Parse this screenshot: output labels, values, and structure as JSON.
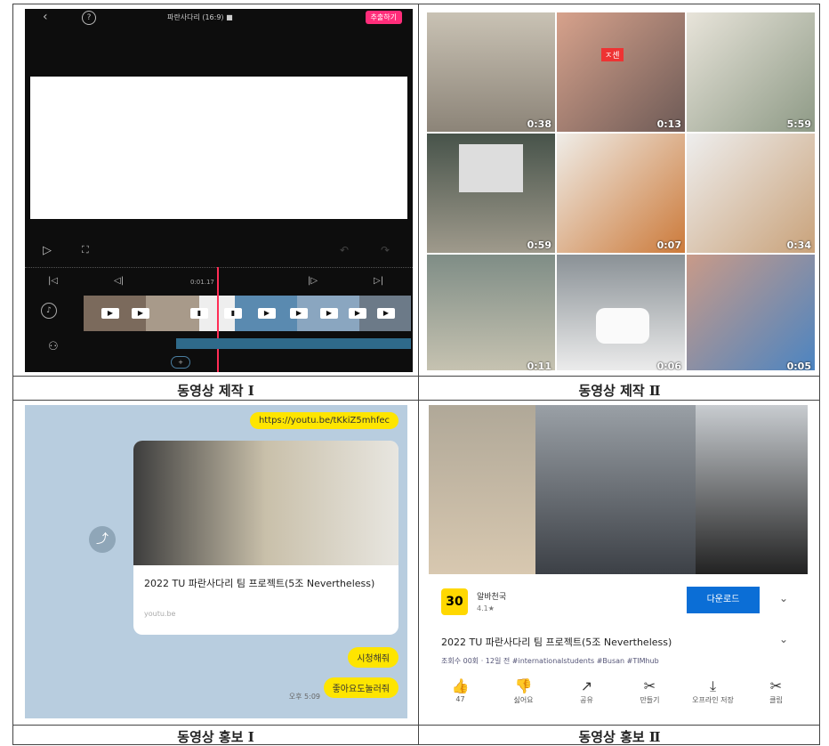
{
  "captions": {
    "c1": "동영상 제작 Ⅰ",
    "c2": "동영상 제작 Ⅱ",
    "c3": "동영상 홍보 Ⅰ",
    "c4": "동영상 홍보 Ⅱ"
  },
  "editor": {
    "title": "파란사다리 (16:9) ■",
    "export_label": "추출하기",
    "timecode": "0:01.17",
    "icons": [
      "back-icon",
      "help-icon",
      "play-icon",
      "fullscreen-icon",
      "undo-icon",
      "redo-icon",
      "speaker-icon",
      "add-media-icon"
    ]
  },
  "gallery": {
    "durations": [
      "0:38",
      "0:13",
      "5:59",
      "0:59",
      "0:07",
      "0:34",
      "0:11",
      "0:06",
      "0:05"
    ]
  },
  "chat": {
    "link": "https://youtu.be/tKkiZ5mhfec",
    "card_title": "2022 TU 파란사다리 팀 프로젝트(5조 Nevertheless)",
    "card_domain": "youtu.be",
    "reply1": "시청해줘",
    "reply2": "좋아요도눌러줘",
    "time": "오후 5:09"
  },
  "youtube": {
    "channel": "알바천국",
    "logo_text": "30",
    "rating": "4.1★",
    "download_label": "다운로드",
    "video_title": "2022 TU 파란사다리 팀 프로젝트(5조 Nevertheless)",
    "subline": "조회수 00회 · 12일 전 #internationalstudents #Busan #TIMhub",
    "actions": [
      {
        "icon": "👍",
        "label": "47"
      },
      {
        "icon": "👎",
        "label": "싫어요"
      },
      {
        "icon": "↗",
        "label": "공유"
      },
      {
        "icon": "✂",
        "label": "만들기"
      },
      {
        "icon": "⤓",
        "label": "오프라인 저장"
      },
      {
        "icon": "✂",
        "label": "클립"
      }
    ]
  }
}
